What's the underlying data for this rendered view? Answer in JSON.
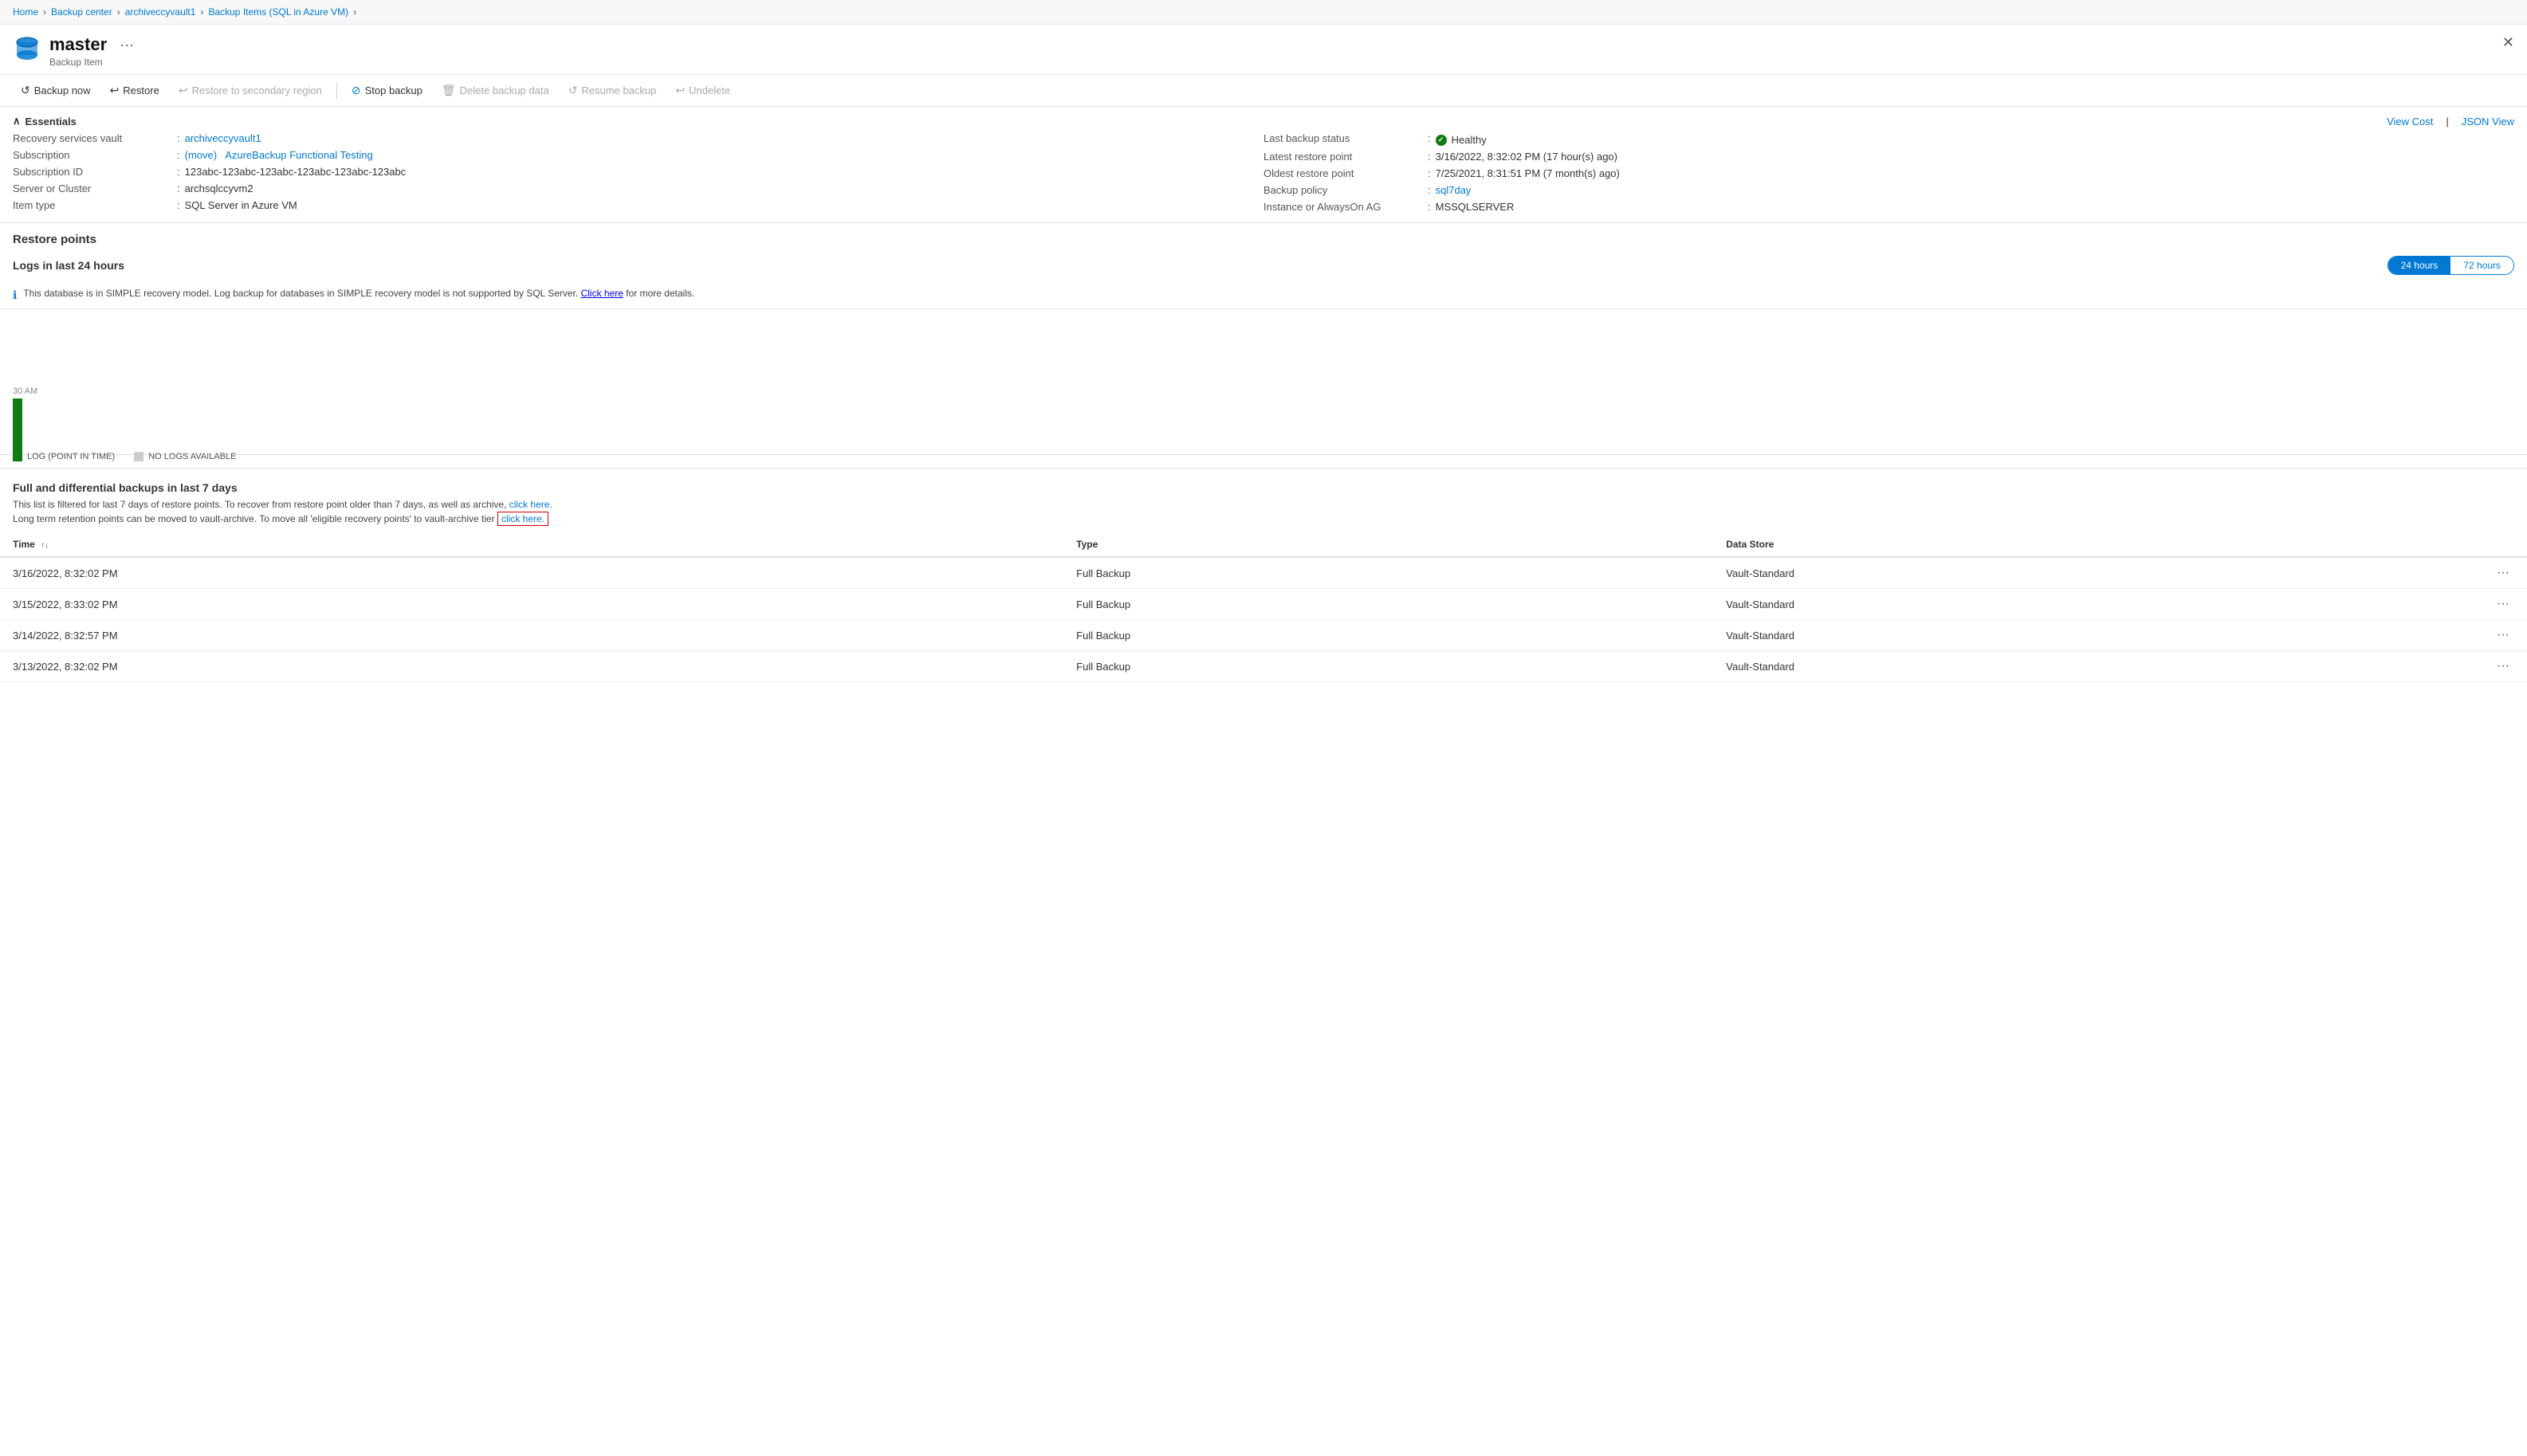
{
  "breadcrumb": {
    "items": [
      {
        "label": "Home",
        "href": "#"
      },
      {
        "label": "Backup center",
        "href": "#"
      },
      {
        "label": "archiveccyvault1",
        "href": "#"
      },
      {
        "label": "Backup Items (SQL in Azure VM)",
        "href": "#"
      }
    ]
  },
  "header": {
    "title": "master",
    "subtitle": "Backup Item",
    "more_label": "···"
  },
  "toolbar": {
    "buttons": [
      {
        "id": "backup-now",
        "label": "Backup now",
        "icon": "backup-icon",
        "disabled": false
      },
      {
        "id": "restore",
        "label": "Restore",
        "icon": "restore-icon",
        "disabled": false
      },
      {
        "id": "restore-secondary",
        "label": "Restore to secondary region",
        "icon": "restore-secondary-icon",
        "disabled": true
      },
      {
        "id": "stop-backup",
        "label": "Stop backup",
        "icon": "stop-icon",
        "disabled": false
      },
      {
        "id": "delete-backup",
        "label": "Delete backup data",
        "icon": "delete-icon",
        "disabled": true
      },
      {
        "id": "resume-backup",
        "label": "Resume backup",
        "icon": "resume-icon",
        "disabled": true
      },
      {
        "id": "undelete",
        "label": "Undelete",
        "icon": "undelete-icon",
        "disabled": true
      }
    ]
  },
  "essentials": {
    "section_label": "Essentials",
    "view_cost_label": "View Cost",
    "json_view_label": "JSON View",
    "left": [
      {
        "label": "Recovery services vault",
        "value": "archiveccyvault1",
        "link": true
      },
      {
        "label": "Subscription",
        "value_parts": [
          {
            "text": "(move)",
            "link": true
          },
          {
            "text": " "
          },
          {
            "text": "AzureBackup Functional Testing",
            "link": true
          }
        ]
      },
      {
        "label": "Subscription ID",
        "value": "123abc-123abc-123abc-123abc-123abc-123abc"
      },
      {
        "label": "Server or Cluster",
        "value": "archsqlccyvm2"
      },
      {
        "label": "Item type",
        "value": "SQL Server in Azure VM"
      }
    ],
    "right": [
      {
        "label": "Last backup status",
        "value": "Healthy",
        "status": true
      },
      {
        "label": "Latest restore point",
        "value": "3/16/2022, 8:32:02 PM (17 hour(s) ago)"
      },
      {
        "label": "Oldest restore point",
        "value": "7/25/2021, 8:31:51 PM (7 month(s) ago)"
      },
      {
        "label": "Backup policy",
        "value": "sql7day",
        "link": true
      },
      {
        "label": "Instance or AlwaysOn AG",
        "value": "MSSQLSERVER"
      }
    ]
  },
  "restore_points": {
    "section_label": "Restore points"
  },
  "logs_section": {
    "title": "Logs in last 24 hours",
    "time_toggle": [
      {
        "label": "24 hours",
        "active": true
      },
      {
        "label": "72 hours",
        "active": false
      }
    ],
    "info_text": "This database is in SIMPLE recovery model. Log backup for databases in SIMPLE recovery model is not supported by SQL Server.",
    "click_here_label": "Click here",
    "info_suffix": "for more details.",
    "time_label": "30 AM",
    "legend": [
      {
        "label": "LOG (POINT IN TIME)",
        "color": "green"
      },
      {
        "label": "NO LOGS AVAILABLE",
        "color": "gray"
      }
    ]
  },
  "full_diff": {
    "title": "Full and differential backups in last 7 days",
    "desc1_prefix": "This list is filtered for last 7 days of restore points. To recover from restore point older than 7 days, as well as archive,",
    "desc1_link": "click here.",
    "desc2_prefix": "Long term retention points can be moved to vault-archive. To move all 'eligible recovery points' to vault-archive tier",
    "desc2_link": "click here.",
    "table": {
      "columns": [
        {
          "label": "Time",
          "sort": true
        },
        {
          "label": "Type",
          "sort": false
        },
        {
          "label": "Data Store",
          "sort": false
        }
      ],
      "rows": [
        {
          "time": "3/16/2022, 8:32:02 PM",
          "type": "Full Backup",
          "datastore": "Vault-Standard"
        },
        {
          "time": "3/15/2022, 8:33:02 PM",
          "type": "Full Backup",
          "datastore": "Vault-Standard"
        },
        {
          "time": "3/14/2022, 8:32:57 PM",
          "type": "Full Backup",
          "datastore": "Vault-Standard"
        },
        {
          "time": "3/13/2022, 8:32:02 PM",
          "type": "Full Backup",
          "datastore": "Vault-Standard"
        }
      ]
    }
  }
}
